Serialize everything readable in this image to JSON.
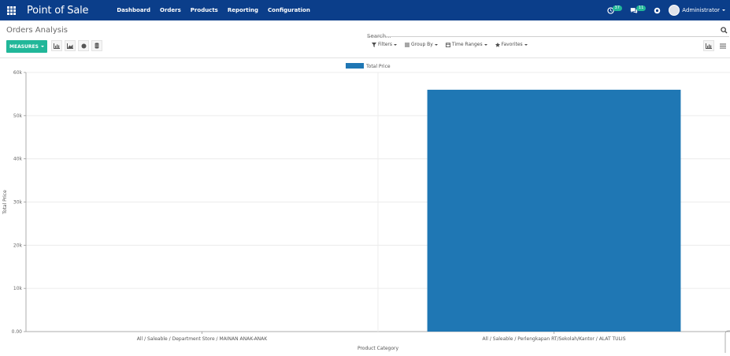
{
  "navbar": {
    "brand": "Point of Sale",
    "menu": [
      "Dashboard",
      "Orders",
      "Products",
      "Reporting",
      "Configuration"
    ],
    "activity_count": "37",
    "messages_count": "11",
    "user_name": "Administrator"
  },
  "control_panel": {
    "breadcrumb": "Orders Analysis",
    "search_placeholder": "Search...",
    "measures_label": "MEASURES",
    "filters_label": "Filters",
    "group_by_label": "Group By",
    "time_ranges_label": "Time Ranges",
    "favorites_label": "Favorites"
  },
  "chart_data": {
    "type": "bar",
    "legend": [
      "Total Price"
    ],
    "legend_position": "top-center",
    "categories": [
      "All / Saleable / Department Store / MAINAN ANAK-ANAK",
      "All / Saleable / Perlengkapan RT/Sekolah/Kantor / ALAT TULIS"
    ],
    "series": [
      {
        "name": "Total Price",
        "values": [
          0,
          56000
        ]
      }
    ],
    "xlabel": "Product Category",
    "ylabel": "Total Price",
    "ylim": [
      0,
      60000
    ],
    "yticks": [
      "0.00",
      "10k",
      "20k",
      "30k",
      "40k",
      "50k",
      "60k"
    ],
    "grid": true,
    "color": "#1f77b4"
  }
}
